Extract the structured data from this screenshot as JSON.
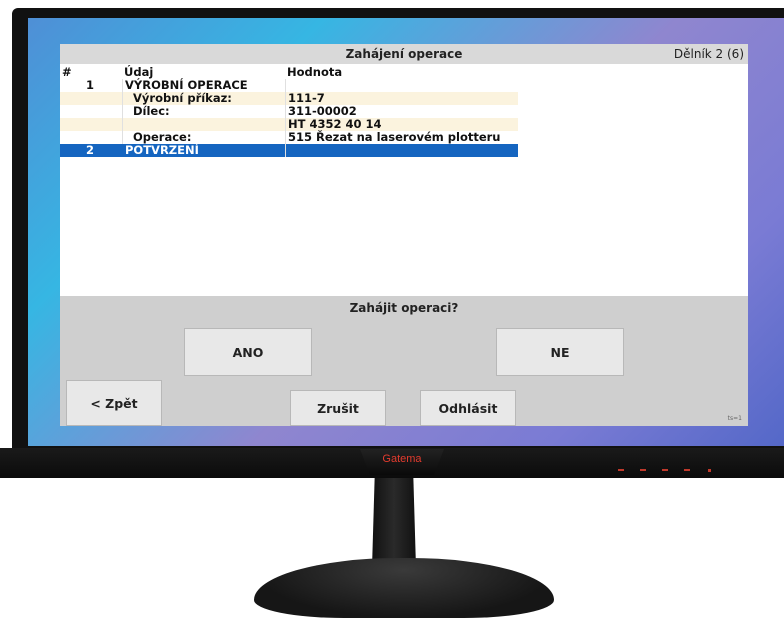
{
  "window": {
    "title": "Zahájení operace",
    "user": "Dělník 2 (6)"
  },
  "table": {
    "headers": [
      "#",
      "Údaj",
      "Hodnota"
    ],
    "rows": [
      {
        "num": "1",
        "label": "VÝROBNÍ OPERACE",
        "value": ""
      },
      {
        "num": "",
        "label": "Výrobní příkaz:",
        "value": "111-7"
      },
      {
        "num": "",
        "label": "Dílec:",
        "value": "311-00002"
      },
      {
        "num": "",
        "label": "",
        "value": "HT 4352 40 14"
      },
      {
        "num": "",
        "label": "Operace:",
        "value": "515 Řezat na laserovém plotteru"
      },
      {
        "num": "2",
        "label": "POTVRZENÍ",
        "value": ""
      }
    ]
  },
  "dialog": {
    "prompt": "Zahájit operaci?",
    "yes_label": "ANO",
    "no_label": "NE"
  },
  "footer": {
    "back_label": "< Zpět",
    "cancel_label": "Zrušit",
    "logout_label": "Odhlásit",
    "corner_label": "ts=1"
  },
  "monitor": {
    "brand": "Gatema"
  },
  "colors": {
    "selected_row": "#1565c0",
    "alt_row": "#fbf3de",
    "brand": "#e23b2e"
  }
}
